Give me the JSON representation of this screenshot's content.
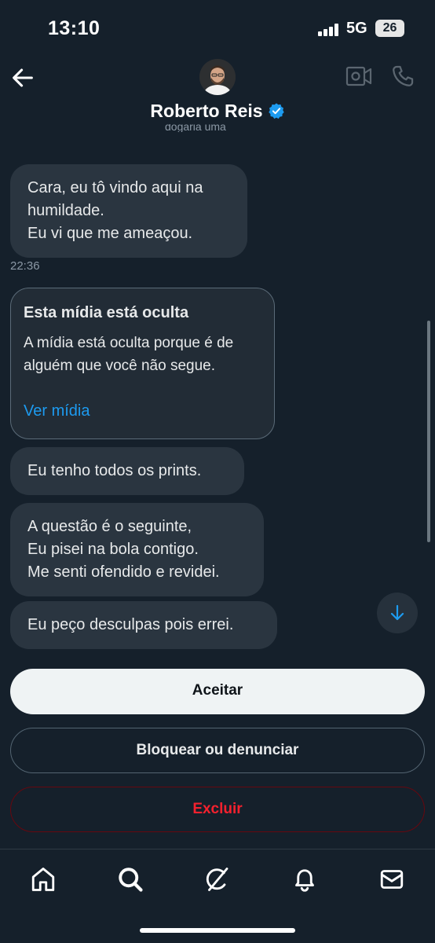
{
  "status_bar": {
    "time": "13:10",
    "network": "5G",
    "battery": "26"
  },
  "header": {
    "name": "Roberto Reis",
    "cutoff_text": "dogaria uma"
  },
  "messages": {
    "m1": {
      "line1": "Cara, eu tô vindo aqui na",
      "line2": "humildade.",
      "line3": "Eu vi que me ameaçou."
    },
    "timestamp": "22:36",
    "hidden_media": {
      "title": "Esta mídia está oculta",
      "desc_line1": "A mídia está oculta porque é de",
      "desc_line2": "alguém que você não segue.",
      "link": "Ver mídia"
    },
    "m2": {
      "line1": "Eu tenho todos os prints."
    },
    "m3": {
      "line1": "A questão é o seguinte,",
      "line2": "Eu pisei na bola contigo.",
      "line3": "Me senti ofendido e revidei."
    },
    "m4": {
      "line1": "Eu peço desculpas pois errei."
    }
  },
  "actions": {
    "accept": "Aceitar",
    "block": "Bloquear ou denunciar",
    "delete": "Excluir"
  },
  "colors": {
    "background": "#15202b",
    "bubble": "#2a3540",
    "accent": "#1d9bf0",
    "danger": "#f4212e"
  },
  "icons": {
    "back": "arrow-left-icon",
    "video": "video-camera-icon",
    "call": "phone-icon",
    "verified": "verified-badge-icon",
    "scroll": "arrow-down-icon",
    "tabs": [
      "home-icon",
      "search-icon",
      "grok-icon",
      "notifications-icon",
      "messages-icon"
    ]
  }
}
